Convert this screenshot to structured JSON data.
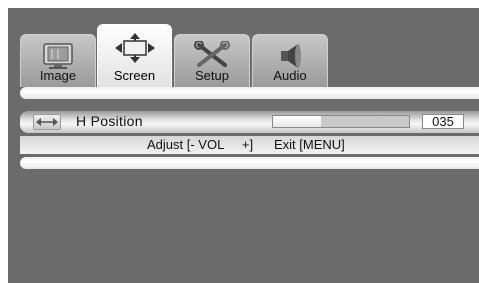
{
  "tabs": [
    {
      "label": "Image",
      "icon": "monitor-icon",
      "active": false
    },
    {
      "label": "Screen",
      "icon": "position-arrows-icon",
      "active": true
    },
    {
      "label": "Setup",
      "icon": "tools-icon",
      "active": false
    },
    {
      "label": "Audio",
      "icon": "speaker-icon",
      "active": false
    }
  ],
  "setting": {
    "icon": "horizontal-arrows-icon",
    "label": "H Position",
    "value": "035",
    "level_fraction": 0.35
  },
  "hint": {
    "adjust": "Adjust [- VOL     +]",
    "exit": "Exit [MENU]"
  },
  "colors": {
    "background": "#6b6b6b",
    "active_tab": "#ffffff",
    "inactive_tab": "#b0b0b0"
  }
}
